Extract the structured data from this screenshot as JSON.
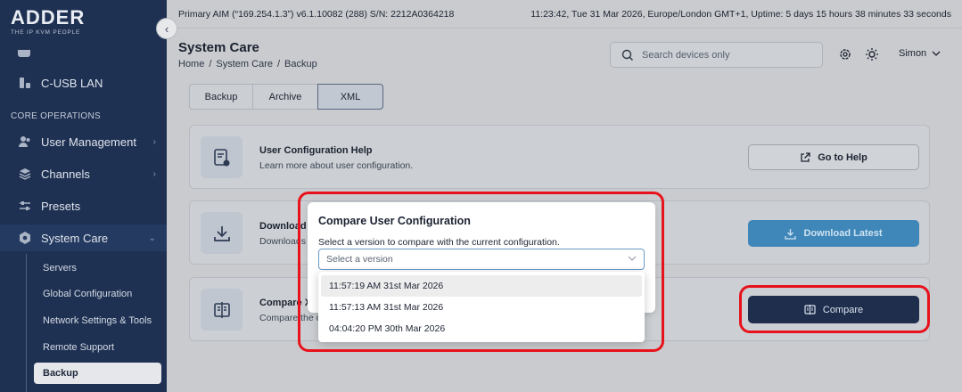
{
  "sidebar": {
    "logo": {
      "word": "ADDER",
      "tagline": "THE IP KVM PEOPLE"
    },
    "collapse_glyph": "‹",
    "top_items": [
      {
        "label": "C-USB LAN",
        "icon": "usb-lan-icon"
      }
    ],
    "section_label": "CORE OPERATIONS",
    "items": [
      {
        "label": "User Management",
        "icon": "users-icon",
        "chevron": "›"
      },
      {
        "label": "Channels",
        "icon": "layers-icon",
        "chevron": "›"
      },
      {
        "label": "Presets",
        "icon": "sliders-icon"
      },
      {
        "label": "System Care",
        "icon": "gear-icon",
        "chevron": "⌄"
      }
    ],
    "sub_items": [
      {
        "label": "Servers"
      },
      {
        "label": "Global Configuration"
      },
      {
        "label": "Network Settings & Tools"
      },
      {
        "label": "Remote Support"
      },
      {
        "label": "Backup",
        "active": true
      }
    ]
  },
  "topbar": {
    "left": "Primary AIM (“169.254.1.3”) v6.1.10082 (288) S/N: 2212A0364218",
    "right": "11:23:42, Tue 31 Mar 2026, Europe/London GMT+1, Uptime: 5 days 15 hours 38 minutes 33 seconds"
  },
  "header": {
    "title": "System Care",
    "breadcrumb": [
      "Home",
      "/",
      "System Care",
      "/",
      "Backup"
    ],
    "search_placeholder": "Search devices only",
    "user": "Simon"
  },
  "tabs": [
    {
      "label": "Backup"
    },
    {
      "label": "Archive"
    },
    {
      "label": "XML",
      "active": true
    }
  ],
  "cards": {
    "help": {
      "title": "User Configuration Help",
      "desc": "Learn more about user configuration.",
      "button": "Go to Help"
    },
    "download": {
      "title": "Download L",
      "desc": "Downloads",
      "button": "Download Latest"
    },
    "compare": {
      "title": "Compare X",
      "desc": "Compare the c",
      "button": "Compare"
    }
  },
  "modal": {
    "title": "Compare User Configuration",
    "desc": "Select a version to compare with the current configuration.",
    "select_placeholder": "Select a version",
    "options": [
      "11:57:19 AM 31st Mar 2026",
      "11:57:13 AM 31st Mar 2026",
      "04:04:20 PM 30th Mar 2026"
    ]
  },
  "colors": {
    "sidebar_bg": "#1f3153",
    "highlight": "#e8121c",
    "primary_blue": "#3f86b9",
    "dark_button": "#1e2e4c"
  }
}
